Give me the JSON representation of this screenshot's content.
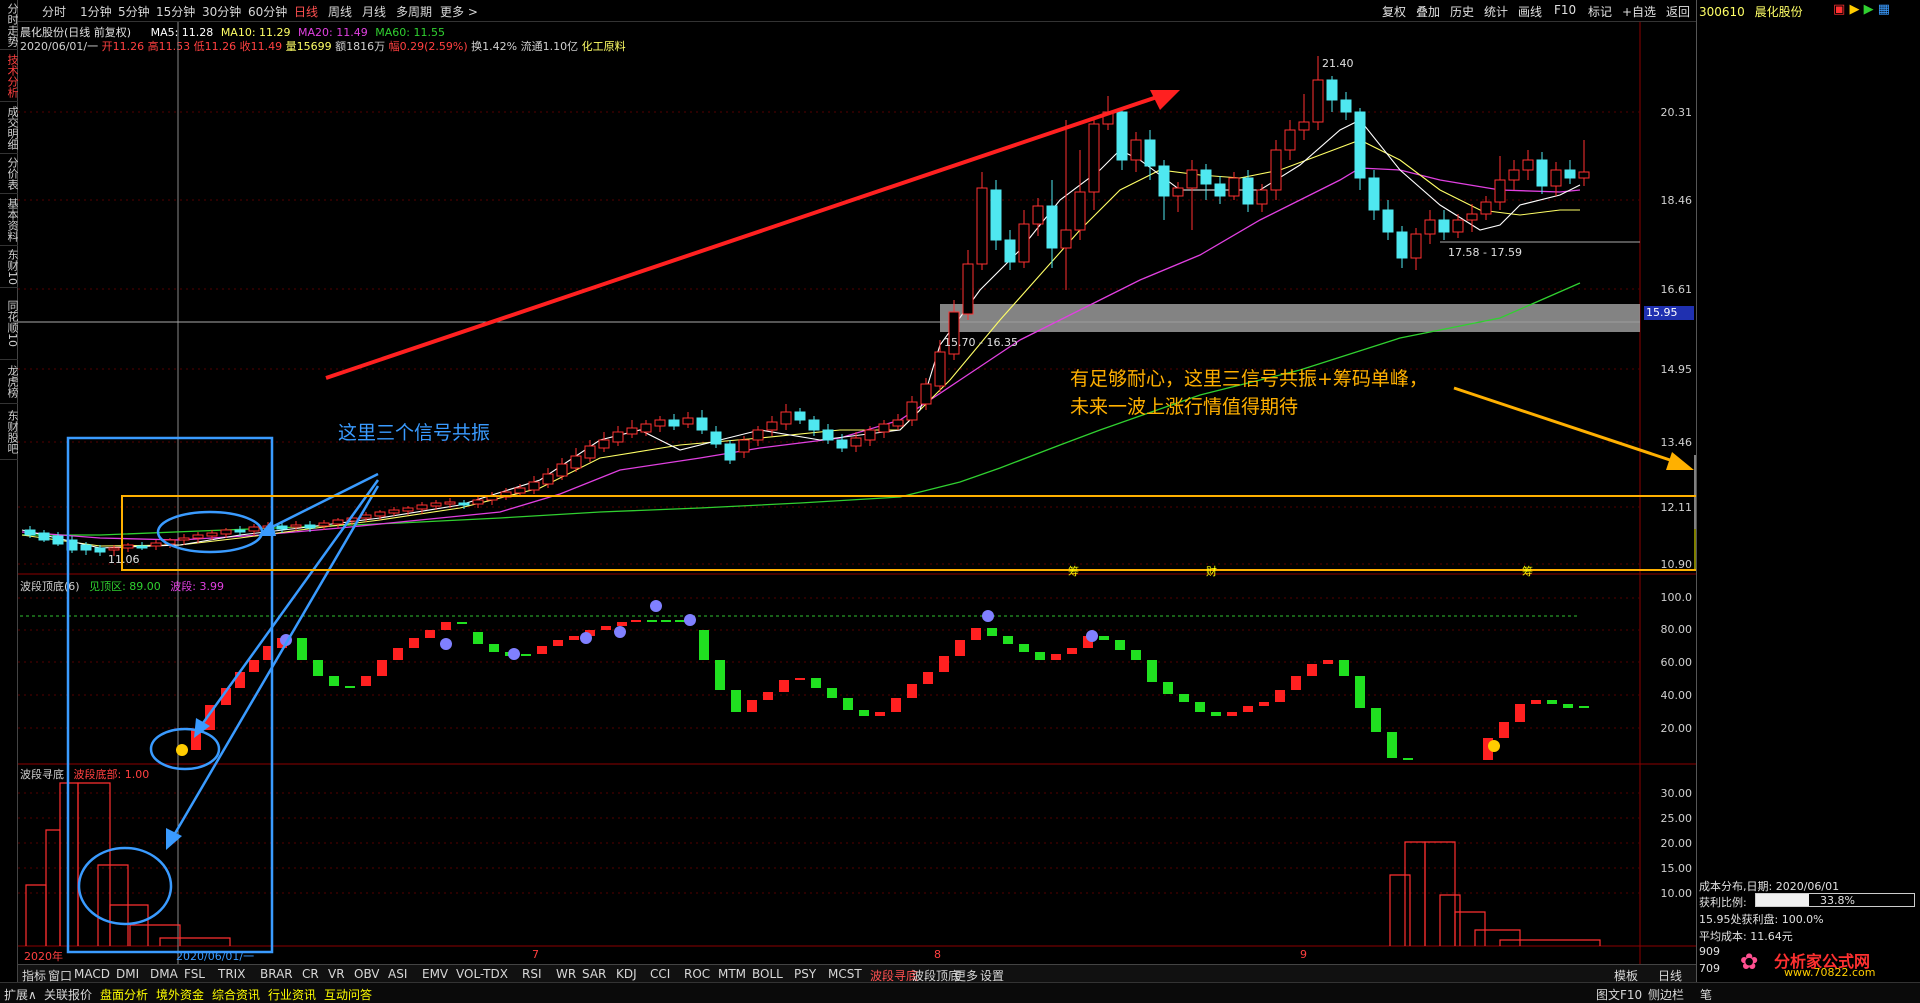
{
  "left_tabs": [
    "分时走势",
    "技术分析",
    "成交明细",
    "分价表",
    "基本资料",
    "东财10",
    "同花顺10",
    "龙虎榜",
    "东财股吧"
  ],
  "periods": [
    "分时",
    "1分钟",
    "5分钟",
    "15分钟",
    "30分钟",
    "60分钟",
    "日线",
    "周线",
    "月线",
    "多周期",
    "更多 >"
  ],
  "tools": [
    "复权",
    "叠加",
    "历史",
    "统计",
    "画线",
    "F10",
    "标记",
    "+自选",
    "返回"
  ],
  "stock_code": "300610",
  "stock_name": "晨化股份",
  "info_line1": {
    "title": "晨化股份(日线 前复权)",
    "ma5": "MA5: 11.28",
    "ma10": "MA10: 11.29",
    "ma20": "MA20: 11.49",
    "ma60": "MA60: 11.55"
  },
  "info_line2": {
    "date": "2020/06/01/一",
    "open": "开11.26",
    "high": "高11.53",
    "low": "低11.26",
    "close": "收11.49",
    "volume": "量15699",
    "amount": "额1816万",
    "change": "幅0.29(2.59%)",
    "turnover": "换1.42%",
    "float": "流通1.10亿",
    "sector": "化工原料"
  },
  "price_axis": [
    "20.31",
    "18.46",
    "16.61",
    "14.95",
    "13.46",
    "12.11",
    "10.90"
  ],
  "price_marker": "15.95",
  "price_labels": {
    "high": "21.40",
    "low": "11.06",
    "gap_zone": "15.70 - 16.35",
    "support": "17.58 - 17.59"
  },
  "chip_markers": [
    "筹",
    "财",
    "筹"
  ],
  "panel2": {
    "title": "波段顶底(6)",
    "label_a": "见顶区: 89.00",
    "label_b": "波段: 3.99",
    "axis": [
      "100.0",
      "80.00",
      "60.00",
      "40.00",
      "20.00"
    ]
  },
  "panel3": {
    "title": "波段寻底",
    "label_a": "波段底部: 1.00",
    "axis": [
      "30.00",
      "25.00",
      "20.00",
      "15.00",
      "10.00"
    ]
  },
  "date_axis": {
    "year": "2020年",
    "cursor": "2020/06/01/一",
    "months": [
      "7",
      "8",
      "9"
    ]
  },
  "annotations": {
    "blue_text": "这里三个信号共振",
    "orange_line1": "有足够耐心，这里三信号共振+筹码单峰，",
    "orange_line2": "未来一波上涨行情值得期待"
  },
  "indicator_tabs": [
    "指标",
    "窗口",
    "MACD",
    "DMI",
    "DMA",
    "FSL",
    "TRIX",
    "BRAR",
    "CR",
    "VR",
    "OBV",
    "ASI",
    "EMV",
    "VOL-TDX",
    "RSI",
    "WR",
    "SAR",
    "KDJ",
    "CCI",
    "ROC",
    "MTM",
    "BOLL",
    "PSY",
    "MCST",
    "波段寻底",
    "波段顶底",
    "更多",
    "设置"
  ],
  "indicator_selected": "波段寻底",
  "bottom_right_tabs": [
    "模板",
    "日线"
  ],
  "status_bar": [
    "扩展∧",
    "关联报价",
    "盘面分析",
    "境外资金",
    "综合资讯",
    "行业资讯",
    "互动问答"
  ],
  "status_right": [
    "图文F10",
    "侧边栏",
    "笔"
  ],
  "chip_panel": {
    "title": "成本分布,日期: 2020/06/01",
    "profit_label": "获利比例:",
    "profit_value": "33.8%",
    "profit_at": "15.95处获利盘: 100.0%",
    "avg_cost": "平均成本: 11.64元",
    "row90": "909",
    "row70": "709"
  },
  "logo_text": "分析家公式网",
  "logo_url": "www.70822.com",
  "colors": {
    "up": "#ff3030",
    "down": "#4fe8f0",
    "ma5": "#ffffff",
    "ma10": "#ffff66",
    "ma20": "#e040e0",
    "ma60": "#30d030",
    "annot_blue": "#3a9bff",
    "annot_orange": "#ffb000",
    "arrow_red": "#ff2020"
  }
}
